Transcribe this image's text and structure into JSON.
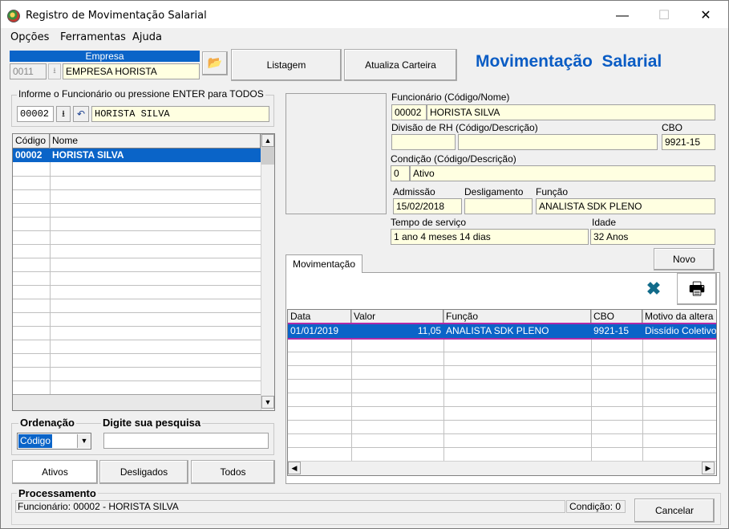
{
  "window": {
    "title": "Registro de Movimentação Salarial"
  },
  "window_controls": {
    "minimize": "—",
    "maximize": "☐",
    "close": "✕"
  },
  "menu": [
    "Opções",
    "Ferramentas",
    "Ajuda"
  ],
  "empresa": {
    "header": "Empresa",
    "code": "0011",
    "name": "EMPRESA HORISTA"
  },
  "toolbar": {
    "listagem": "Listagem",
    "atualiza": "Atualiza Carteira"
  },
  "page_title": "Movimentação  Salarial",
  "search_funcionario": {
    "label": "Informe o Funcionário ou pressione ENTER para TODOS",
    "code": "00002",
    "name": "HORISTA SILVA"
  },
  "left_grid": {
    "columns": [
      "Código",
      "Nome"
    ],
    "rows": [
      {
        "codigo": "00002",
        "nome": "HORISTA SILVA"
      }
    ]
  },
  "ordenacao": {
    "label": "Ordenação",
    "value": "Código"
  },
  "pesquisa": {
    "label": "Digite sua pesquisa",
    "value": ""
  },
  "filter_buttons": {
    "ativos": "Ativos",
    "desligados": "Desligados",
    "todos": "Todos"
  },
  "details": {
    "funcionario_label": "Funcionário (Código/Nome)",
    "funcionario_code": "00002",
    "funcionario_name": "HORISTA SILVA",
    "divisao_label": "Divisão de RH (Código/Descrição)",
    "divisao_code": "",
    "divisao_desc": "",
    "cbo_label": "CBO",
    "cbo_value": "9921-15",
    "condicao_label": "Condição (Código/Descrição)",
    "condicao_code": "0",
    "condicao_desc": "Ativo",
    "admissao_label": "Admissão",
    "admissao_value": "15/02/2018",
    "desligamento_label": "Desligamento",
    "desligamento_value": "",
    "funcao_label": "Função",
    "funcao_value": "ANALISTA SDK PLENO",
    "tempo_label": "Tempo de serviço",
    "tempo_value": "1 ano 4 meses 14 dias",
    "idade_label": "Idade",
    "idade_value": "32 Anos"
  },
  "tab": {
    "movimentacao": "Movimentação"
  },
  "novo_button": "Novo",
  "mov_grid": {
    "columns": [
      "Data",
      "Valor",
      "Função",
      "CBO",
      "Motivo da altera"
    ],
    "rows": [
      {
        "data": "01/01/2019",
        "valor": "11,05",
        "funcao": "ANALISTA SDK PLENO",
        "cbo": "9921-15",
        "motivo": "Dissídio Coletivo"
      }
    ]
  },
  "status": {
    "header": "Processamento",
    "text": "Funcionário: 00002 - HORISTA SILVA",
    "condicao": "Condição: 0"
  },
  "cancelar_button": "Cancelar",
  "colors": {
    "selection": "#0a64c8",
    "title_blue": "#0a5cc4",
    "field_yellow": "#ffffe1"
  }
}
